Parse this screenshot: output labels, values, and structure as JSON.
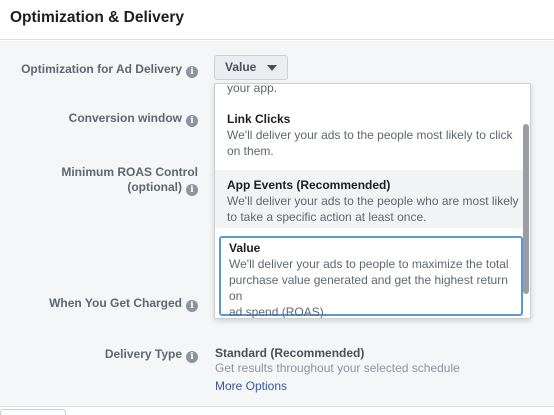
{
  "header": {
    "title": "Optimization & Delivery"
  },
  "fields": {
    "optimization_label": "Optimization for Ad Delivery",
    "conversion_window_label": "Conversion window",
    "min_roas_label_line1": "Minimum ROAS Control",
    "min_roas_label_line2": "(optional)",
    "when_charged_label": "When You Get Charged",
    "delivery_type_label": "Delivery Type",
    "info_glyph": "i"
  },
  "optimization_select": {
    "value": "Value"
  },
  "dropdown": {
    "partial_desc": "your app.",
    "options": [
      {
        "title": "Link Clicks",
        "desc_line1": "We'll deliver your ads to the people most likely to click",
        "desc_line2": "on them."
      },
      {
        "title": "App Events (Recommended)",
        "desc_line1": "We'll deliver your ads to the people who are most likely",
        "desc_line2": "to take a specific action at least once."
      },
      {
        "title": "Value",
        "desc_line1": "We'll deliver your ads to people to maximize the total",
        "desc_line2": "purchase value generated and get the highest return on",
        "desc_line3": "ad spend (ROAS)."
      }
    ]
  },
  "delivery": {
    "type": "Standard (Recommended)",
    "description": "Get results throughout your selected schedule",
    "more_options": "More Options"
  },
  "colors": {
    "selected_border": "#5b9bd5",
    "link": "#385898",
    "panel_bg": "#f5f6f7"
  }
}
